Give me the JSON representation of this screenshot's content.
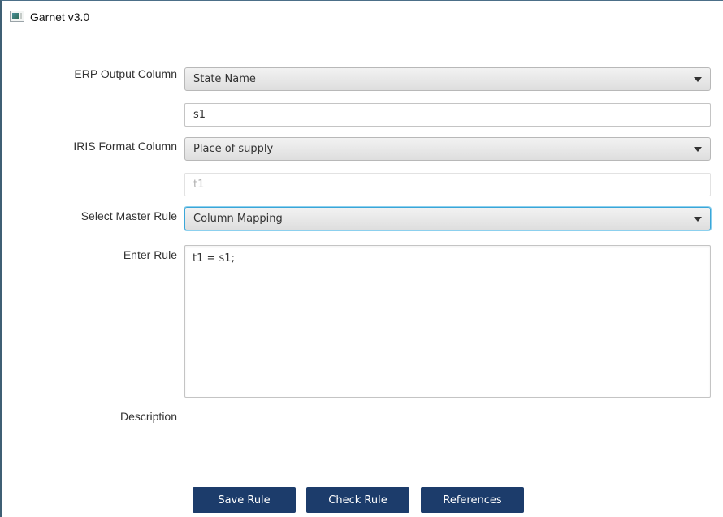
{
  "window": {
    "title": "Garnet v3.0",
    "icon": "app-window-icon"
  },
  "form": {
    "erp_output_column": {
      "label": "ERP Output Column",
      "selected": "State Name",
      "alias_value": "s1"
    },
    "iris_format_column": {
      "label": "IRIS Format Column",
      "selected": "Place of supply",
      "alias_value": "t1",
      "alias_disabled": true
    },
    "master_rule": {
      "label": "Select Master Rule",
      "selected": "Column Mapping",
      "focused": true
    },
    "enter_rule": {
      "label": "Enter Rule",
      "value": "t1 = s1;"
    },
    "description": {
      "label": "Description",
      "value": ""
    }
  },
  "buttons": {
    "save_rule": "Save Rule",
    "check_rule": "Check Rule",
    "references": "References"
  },
  "colors": {
    "button_bg": "#1c3c6b",
    "button_text": "#ffffff",
    "focus_border": "#3aa6d8",
    "window_border": "#3f5f74"
  }
}
